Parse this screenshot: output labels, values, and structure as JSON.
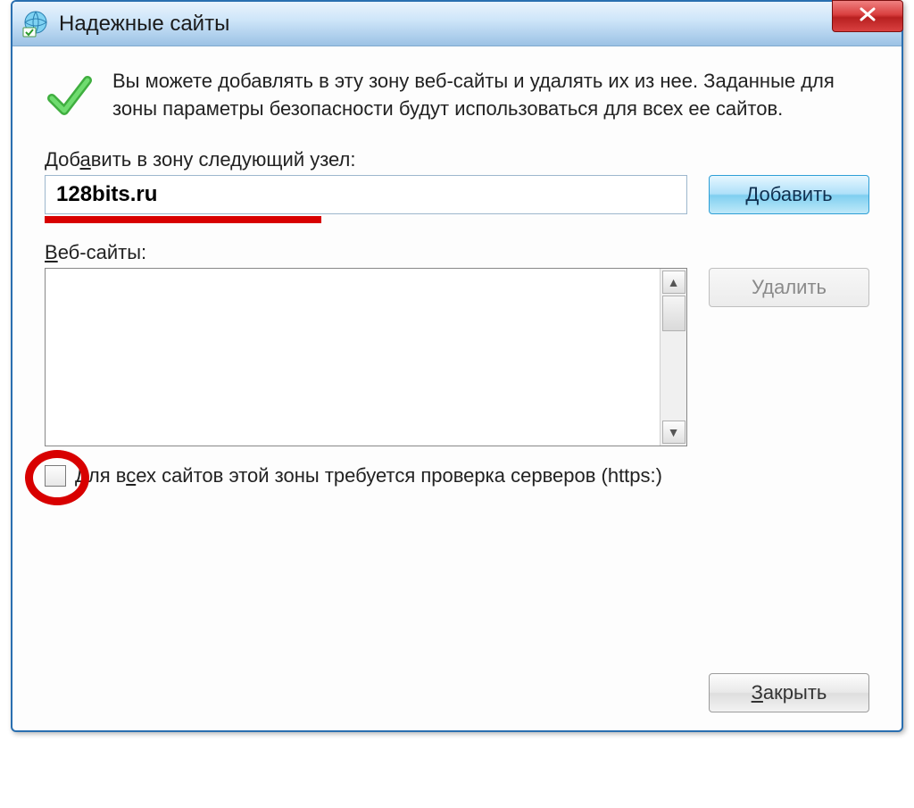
{
  "window": {
    "title": "Надежные сайты"
  },
  "info": {
    "text": "Вы можете добавлять в эту зону веб-сайты и удалять их из нее. Заданные для зоны параметры безопасности будут использоваться для всех ее сайтов."
  },
  "add": {
    "label_pre": "Доб",
    "label_u": "а",
    "label_post": "вить в зону следующий узел:",
    "value": "128bits.ru",
    "button": "Добавить"
  },
  "list": {
    "label_u": "В",
    "label_post": "еб-сайты:",
    "remove_button": "Удалить"
  },
  "checkbox": {
    "label_pre": "Для в",
    "label_u": "с",
    "label_post": "ех сайтов этой зоны требуется проверка серверов (https:)"
  },
  "footer": {
    "close_u": "З",
    "close_post": "акрыть"
  }
}
